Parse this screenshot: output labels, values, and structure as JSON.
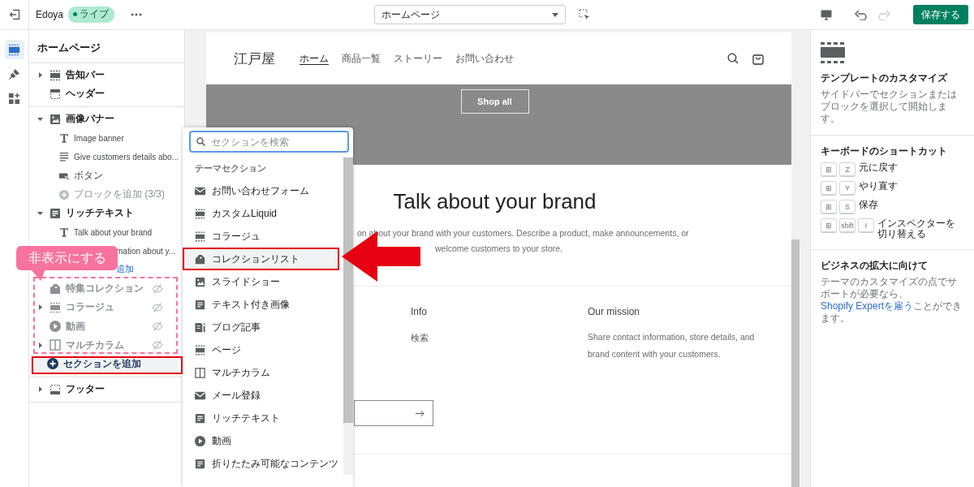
{
  "topbar": {
    "store": "Edoya",
    "status": "ライブ",
    "page_select": "ホームページ",
    "save": "保存する",
    "undo_disabled": false,
    "redo_disabled": true
  },
  "rail": [
    {
      "kind": "sections",
      "selected": true
    },
    {
      "kind": "theme",
      "selected": false
    },
    {
      "kind": "apps",
      "selected": false
    }
  ],
  "sidebar": {
    "title": "ホームページ",
    "groups": [
      {
        "sections": [
          {
            "kind": "dashed",
            "label": "告知バー",
            "expanded": false,
            "hidden": false
          },
          {
            "kind": "header",
            "label": "ヘッダー",
            "hidden": false
          }
        ]
      },
      {
        "sections": [
          {
            "kind": "image",
            "label": "画像バナー",
            "expanded": true,
            "hidden": false,
            "blocks": [
              {
                "label": "Image banner",
                "kind": "text",
                "disabled": false,
                "link": false
              },
              {
                "label": "Give customers details abo...",
                "kind": "lines",
                "disabled": false,
                "link": false
              },
              {
                "label": "ボタン",
                "kind": "button",
                "disabled": false,
                "link": false
              },
              {
                "label": "ブロックを追加 (3/3)",
                "kind": "add",
                "disabled": true,
                "link": false
              }
            ]
          },
          {
            "kind": "richtext",
            "label": "リッチテキスト",
            "expanded": true,
            "hidden": false,
            "blocks": [
              {
                "label": "Talk about your brand",
                "kind": "text",
                "disabled": false,
                "link": false
              },
              {
                "label": "mation about y...",
                "kind": "covered",
                "disabled": false,
                "link": false
              },
              {
                "label": "追加",
                "kind": "covered",
                "disabled": false,
                "link": true
              }
            ]
          },
          {
            "kind": "tag",
            "label": "特集コレクション",
            "hidden": true
          },
          {
            "kind": "dashed",
            "label": "コラージュ",
            "expanded": false,
            "hidden": true
          },
          {
            "kind": "video",
            "label": "動画",
            "hidden": true
          },
          {
            "kind": "columns",
            "label": "マルチカラム",
            "expanded": false,
            "hidden": true
          },
          {
            "kind": "add_section",
            "label": "セクションを追加"
          }
        ]
      },
      {
        "sections": [
          {
            "kind": "footer",
            "label": "フッター",
            "expanded": false,
            "hidden": false
          }
        ]
      }
    ]
  },
  "preview": {
    "logo": "江戸屋",
    "nav": [
      {
        "label": "ホーム",
        "selected": true
      },
      {
        "label": "商品一覧",
        "selected": false
      },
      {
        "label": "ストーリー",
        "selected": false
      },
      {
        "label": "お問い合わせ",
        "selected": false
      }
    ],
    "banner_button": "Shop all",
    "heading": "Talk about your brand",
    "text_lines": [
      "on about your brand with your customers. Describe a product, make announcements, or",
      "welcome customers to your store."
    ],
    "footer": {
      "columns": [
        {
          "heading": "Info",
          "items": [
            "検索"
          ]
        },
        {
          "heading": "Our mission",
          "text": "Share contact information, store details, and brand content with your customers."
        }
      ]
    }
  },
  "section_picker": {
    "placeholder": "セクションを検索",
    "heading": "テーマセクション",
    "items": [
      {
        "label": "お問い合わせフォーム",
        "kind": "mail",
        "selected": false
      },
      {
        "label": "カスタムLiquid",
        "kind": "dashed",
        "selected": false
      },
      {
        "label": "コラージュ",
        "kind": "dashed",
        "selected": false
      },
      {
        "label": "コレクションリスト",
        "kind": "tag",
        "selected": true
      },
      {
        "label": "スライドショー",
        "kind": "image",
        "selected": false
      },
      {
        "label": "テキスト付き画像",
        "kind": "richtext",
        "selected": false
      },
      {
        "label": "ブログ記事",
        "kind": "blog",
        "selected": false
      },
      {
        "label": "ページ",
        "kind": "dashed",
        "selected": false
      },
      {
        "label": "マルチカラム",
        "kind": "columns",
        "selected": false
      },
      {
        "label": "メール登録",
        "kind": "mail",
        "selected": false
      },
      {
        "label": "リッチテキスト",
        "kind": "richtext",
        "selected": false
      },
      {
        "label": "動画",
        "kind": "video",
        "selected": false
      },
      {
        "label": "折りたたみ可能なコンテンツ",
        "kind": "richtext",
        "selected": false
      }
    ]
  },
  "inspector": {
    "title": "テンプレートのカスタマイズ",
    "description": "サイドバーでセクションまたはブロックを選択して開始します。",
    "shortcuts_title": "キーボードのショートカット",
    "shortcuts": [
      {
        "keys": [
          "⊞",
          "Z"
        ],
        "label": "元に戻す"
      },
      {
        "keys": [
          "⊞",
          "Y"
        ],
        "label": "やり直す"
      },
      {
        "keys": [
          "⊞",
          "S"
        ],
        "label": "保存"
      },
      {
        "keys": [
          "⊞",
          "shift",
          "I"
        ],
        "label": "インスペクターを切り替える"
      }
    ],
    "growth_title": "ビジネスの拡大に向けて",
    "growth_text": {
      "before": "テーマのカスタマイズの点でサポートが必要なら、",
      "link": "Shopify Expertを雇う",
      "after": "ことができます。"
    }
  },
  "annotation": {
    "callout": "非表示にする"
  }
}
